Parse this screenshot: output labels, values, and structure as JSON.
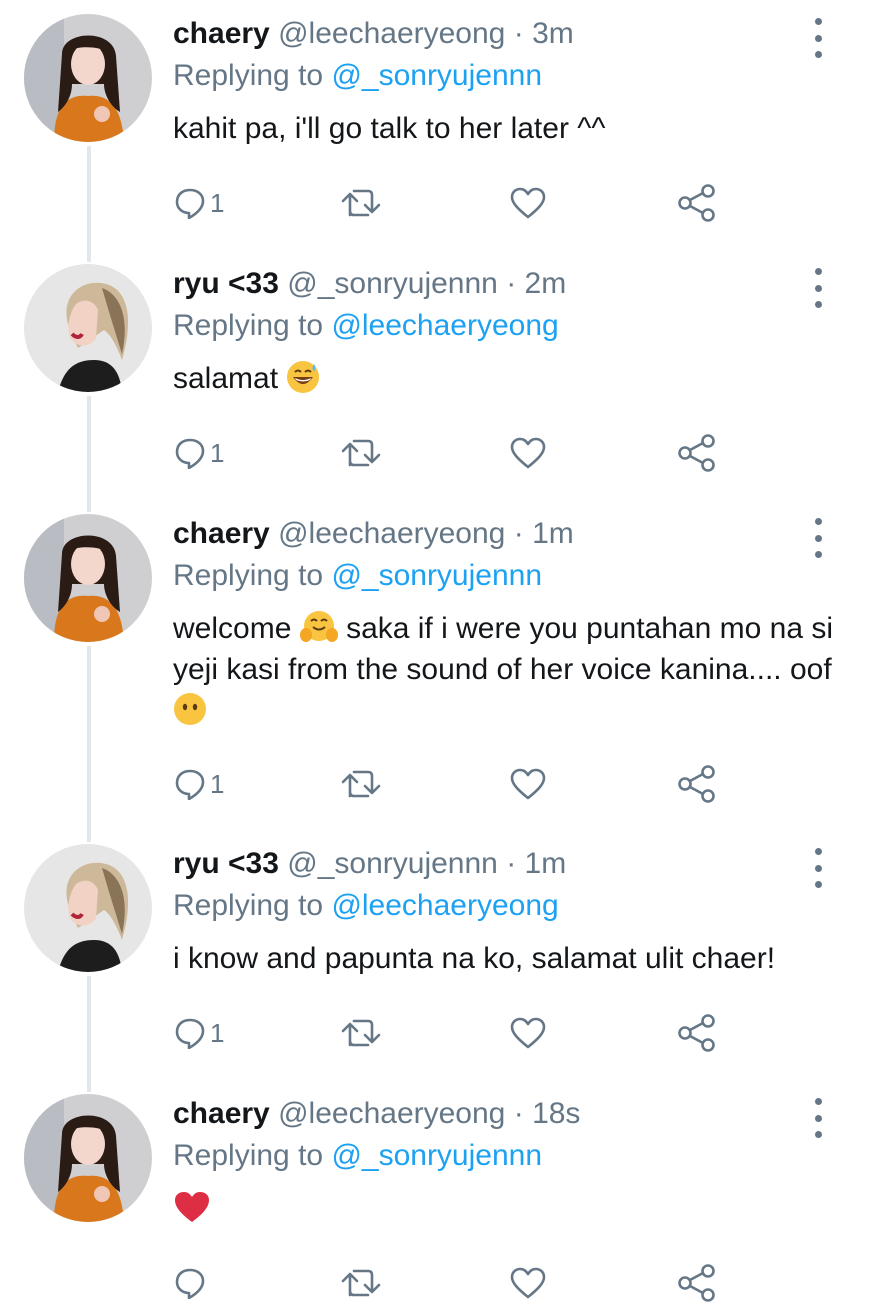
{
  "tweets": [
    {
      "name": "chaery",
      "handle": "@leechaeryeong",
      "dot": "·",
      "time": "3m",
      "replying_label": "Replying to",
      "replying_to": "@_sonryujennn",
      "text": "kahit pa, i'll go talk to her later ^^",
      "reply_count": "1",
      "avatar": "chaery"
    },
    {
      "name": "ryu <33",
      "handle": "@_sonryujennn",
      "dot": "·",
      "time": "2m",
      "replying_label": "Replying to",
      "replying_to": "@leechaeryeong",
      "text": "salamat",
      "emoji": "grinning-sweat-emoji",
      "reply_count": "1",
      "avatar": "ryu"
    },
    {
      "name": "chaery",
      "handle": "@leechaeryeong",
      "dot": "·",
      "time": "1m",
      "replying_label": "Replying to",
      "replying_to": "@_sonryujennn",
      "text_part1": "welcome",
      "text_part2": "saka if i were you puntahan mo na si yeji kasi from the sound of her voice kanina.... oof",
      "emoji1": "hugging-face-emoji",
      "emoji2": "no-mouth-face-emoji",
      "reply_count": "1",
      "avatar": "chaery"
    },
    {
      "name": "ryu <33",
      "handle": "@_sonryujennn",
      "dot": "·",
      "time": "1m",
      "replying_label": "Replying to",
      "replying_to": "@leechaeryeong",
      "text": "i know and papunta na ko, salamat ulit chaer!",
      "reply_count": "1",
      "avatar": "ryu"
    },
    {
      "name": "chaery",
      "handle": "@leechaeryeong",
      "dot": "·",
      "time": "18s",
      "replying_label": "Replying to",
      "replying_to": "@_sonryujennn",
      "emoji": "red-heart-emoji",
      "reply_count": "",
      "avatar": "chaery"
    }
  ],
  "colors": {
    "text": "#14171a",
    "muted": "#657786",
    "link": "#1da1f2",
    "thread_line": "#e1e8ed",
    "heart": "#e0245e"
  },
  "icons": [
    "reply-icon",
    "retweet-icon",
    "like-icon",
    "share-icon",
    "more-options-icon"
  ]
}
